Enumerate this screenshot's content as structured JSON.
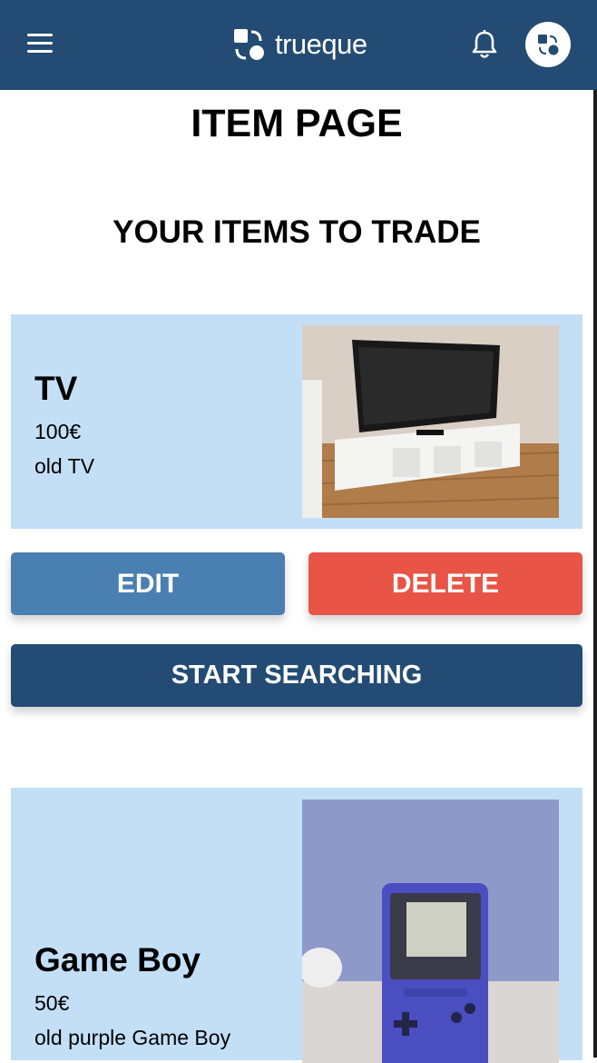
{
  "header": {
    "logo_text": "trueque",
    "menu_icon": "hamburger-icon",
    "bell_icon": "bell-icon",
    "avatar_icon": "trueque-logo-icon",
    "background": "#244b73"
  },
  "page": {
    "title": "ITEM PAGE",
    "section_title": "YOUR ITEMS TO TRADE"
  },
  "items": [
    {
      "name": "TV",
      "price": "100€",
      "description": "old TV"
    },
    {
      "name": "Game Boy",
      "price": "50€",
      "description": "old purple Game Boy"
    }
  ],
  "actions": {
    "edit_label": "EDIT",
    "delete_label": "DELETE",
    "search_label": "START SEARCHING"
  },
  "colors": {
    "card_bg": "#c3dff6",
    "edit": "#4a7fb2",
    "delete": "#e85445",
    "primary": "#244b73"
  }
}
